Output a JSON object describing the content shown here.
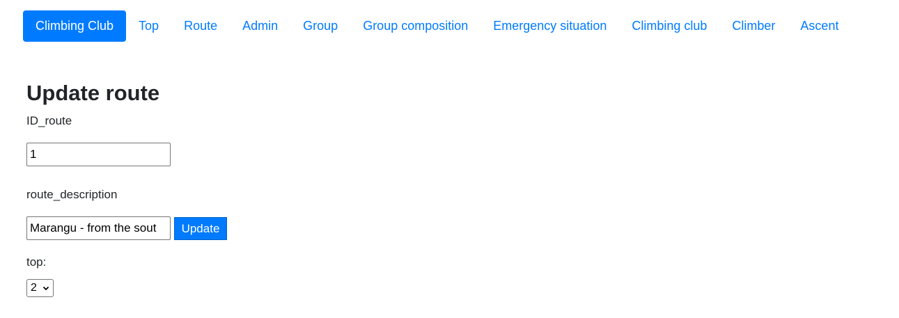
{
  "nav": {
    "brand": "Climbing Club",
    "items": [
      {
        "label": "Top"
      },
      {
        "label": "Route"
      },
      {
        "label": "Admin"
      },
      {
        "label": "Group"
      },
      {
        "label": "Group composition"
      },
      {
        "label": "Emergency situation"
      },
      {
        "label": "Climbing club"
      },
      {
        "label": "Climber"
      },
      {
        "label": "Ascent"
      }
    ]
  },
  "form": {
    "title": "Update route",
    "id_label": "ID_route",
    "id_value": "1",
    "description_label": "route_description",
    "description_value": "Marangu - from the sout",
    "update_label": "Update",
    "top_label": "top:",
    "top_selected": "2"
  },
  "colors": {
    "primary": "#007bff",
    "text": "#212529"
  }
}
